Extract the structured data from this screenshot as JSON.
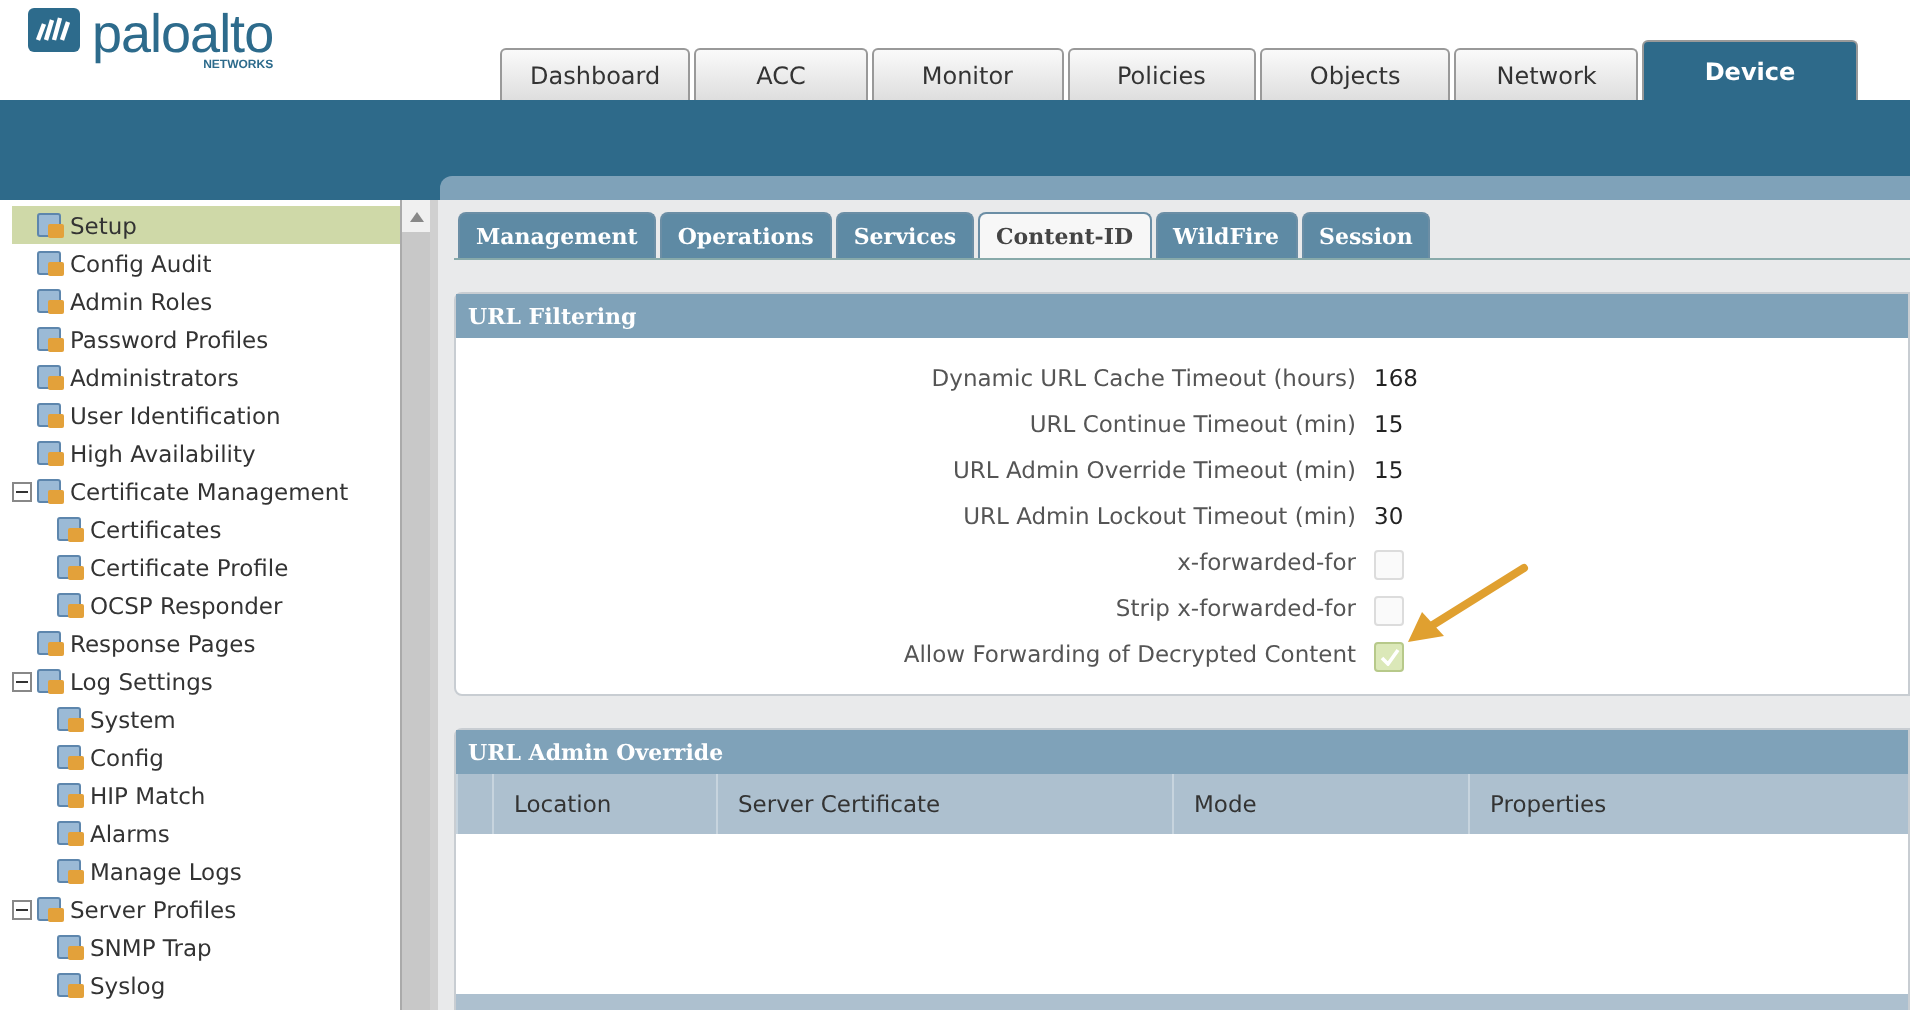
{
  "logo": {
    "name": "paloalto",
    "tagline": "NETWORKS"
  },
  "main_tabs": [
    {
      "label": "Dashboard",
      "selected": false
    },
    {
      "label": "ACC",
      "selected": false
    },
    {
      "label": "Monitor",
      "selected": false
    },
    {
      "label": "Policies",
      "selected": false
    },
    {
      "label": "Objects",
      "selected": false
    },
    {
      "label": "Network",
      "selected": false
    },
    {
      "label": "Device",
      "selected": true
    }
  ],
  "sidebar": {
    "items": [
      {
        "label": "Setup",
        "selected": true
      },
      {
        "label": "Config Audit",
        "selected": false
      },
      {
        "label": "Admin Roles",
        "selected": false
      },
      {
        "label": "Password Profiles",
        "selected": false
      },
      {
        "label": "Administrators",
        "selected": false
      },
      {
        "label": "User Identification",
        "selected": false
      },
      {
        "label": "High Availability",
        "selected": false
      },
      {
        "label": "Certificate Management",
        "selected": false,
        "expanded": true,
        "children": [
          {
            "label": "Certificates",
            "selected": false
          },
          {
            "label": "Certificate Profile",
            "selected": false
          },
          {
            "label": "OCSP Responder",
            "selected": false
          }
        ]
      },
      {
        "label": "Response Pages",
        "selected": false
      },
      {
        "label": "Log Settings",
        "selected": false,
        "expanded": true,
        "children": [
          {
            "label": "System",
            "selected": false
          },
          {
            "label": "Config",
            "selected": false
          },
          {
            "label": "HIP Match",
            "selected": false
          },
          {
            "label": "Alarms",
            "selected": false
          },
          {
            "label": "Manage Logs",
            "selected": false
          }
        ]
      },
      {
        "label": "Server Profiles",
        "selected": false,
        "expanded": true,
        "children": [
          {
            "label": "SNMP Trap",
            "selected": false
          },
          {
            "label": "Syslog",
            "selected": false
          }
        ]
      }
    ]
  },
  "sub_tabs": [
    {
      "label": "Management",
      "selected": false
    },
    {
      "label": "Operations",
      "selected": false
    },
    {
      "label": "Services",
      "selected": false
    },
    {
      "label": "Content-ID",
      "selected": true
    },
    {
      "label": "WildFire",
      "selected": false
    },
    {
      "label": "Session",
      "selected": false
    }
  ],
  "url_filtering": {
    "title": "URL Filtering",
    "fields": [
      {
        "kind": "text",
        "label": "Dynamic URL Cache Timeout (hours)",
        "value": "168"
      },
      {
        "kind": "text",
        "label": "URL Continue Timeout (min)",
        "value": "15"
      },
      {
        "kind": "text",
        "label": "URL Admin Override Timeout (min)",
        "value": "15"
      },
      {
        "kind": "text",
        "label": "URL Admin Lockout Timeout (min)",
        "value": "30"
      },
      {
        "kind": "checkbox",
        "label": "x-forwarded-for",
        "checked": false
      },
      {
        "kind": "checkbox",
        "label": "Strip x-forwarded-for",
        "checked": false
      },
      {
        "kind": "checkbox",
        "label": "Allow Forwarding of Decrypted Content",
        "checked": true,
        "annotated": true
      }
    ]
  },
  "url_admin_override": {
    "title": "URL Admin Override",
    "columns": [
      "Location",
      "Server Certificate",
      "Mode",
      "Properties"
    ]
  }
}
